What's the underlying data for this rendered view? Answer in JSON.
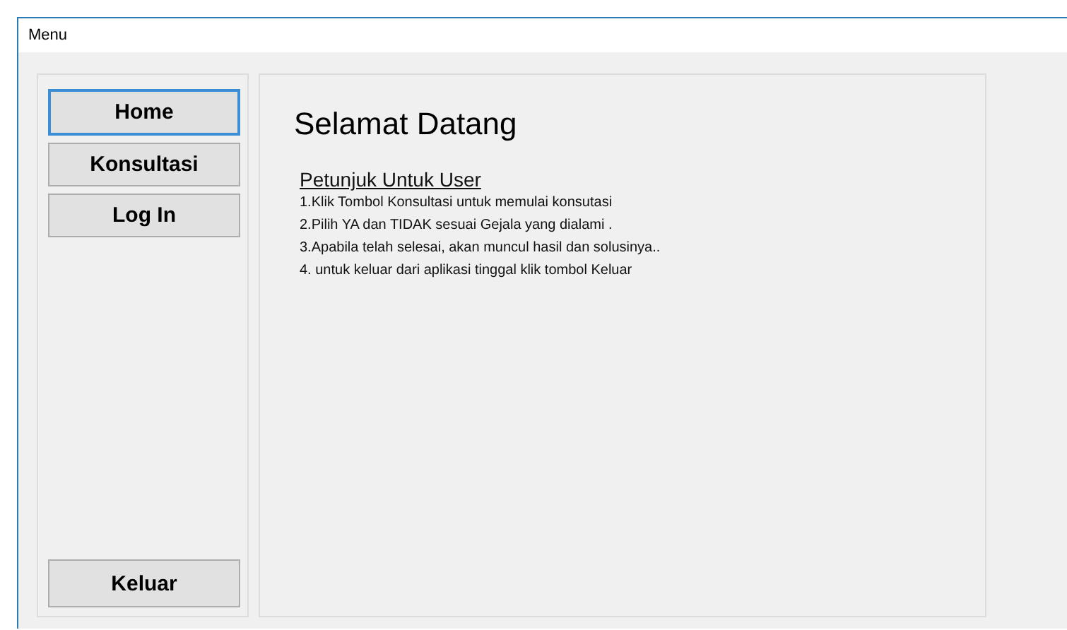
{
  "window": {
    "title": "Menu"
  },
  "sidebar": {
    "buttons": [
      {
        "label": "Home",
        "selected": true
      },
      {
        "label": "Konsultasi",
        "selected": false
      },
      {
        "label": "Log In",
        "selected": false
      }
    ],
    "exit_button": "Keluar"
  },
  "content": {
    "heading": "Selamat Datang",
    "subheading": "Petunjuk Untuk User",
    "steps": [
      "1.Klik Tombol Konsultasi untuk memulai konsutasi",
      "2.Pilih YA dan TIDAK sesuai Gejala yang dialami .",
      "3.Apabila telah selesai, akan muncul hasil dan solusinya..",
      "4. untuk keluar dari aplikasi tinggal klik tombol Keluar"
    ]
  }
}
